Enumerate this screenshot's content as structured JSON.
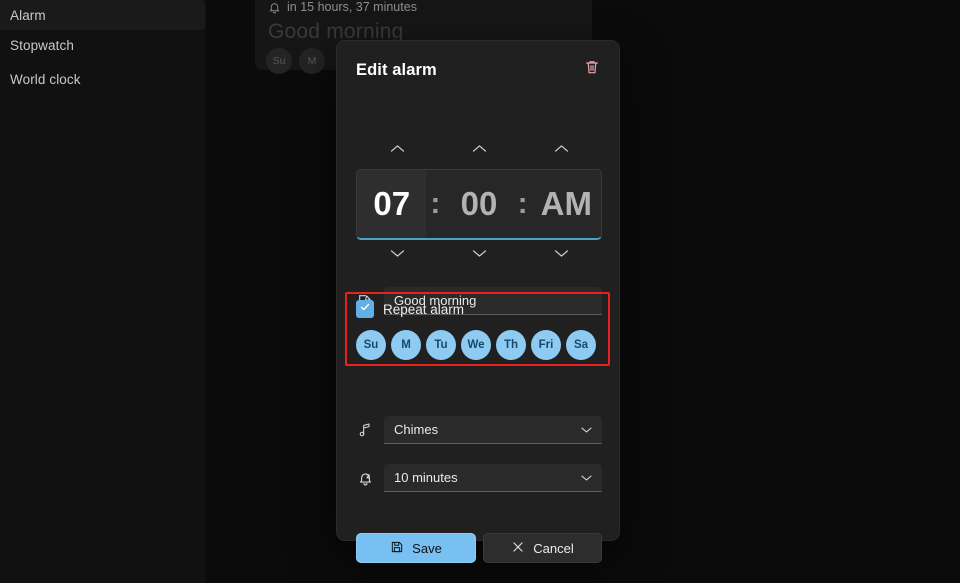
{
  "sidebar": {
    "items": [
      {
        "label": "Alarm",
        "selected": true
      },
      {
        "label": "Stopwatch",
        "selected": false
      },
      {
        "label": "World clock",
        "selected": false
      }
    ]
  },
  "background_alarm": {
    "bell_icon": "bell-icon",
    "countdown": "in 15 hours, 37 minutes",
    "title": "Good morning",
    "days": [
      "Su",
      "M"
    ]
  },
  "dialog": {
    "title": "Edit alarm",
    "delete_icon": "trash-icon",
    "time": {
      "hour": "07",
      "minute": "00",
      "meridiem": "AM",
      "colon": ":",
      "up_icon": "chevron-up-icon",
      "down_icon": "chevron-down-icon",
      "selected_segment": "hour",
      "underline_color": "#4aa3c7"
    },
    "name_field": {
      "icon": "edit-pencil-icon",
      "value": "Good morning"
    },
    "repeat": {
      "label": "Repeat alarm",
      "checked": true,
      "check_icon": "check-icon",
      "days": [
        {
          "label": "Su",
          "on": true
        },
        {
          "label": "M",
          "on": true
        },
        {
          "label": "Tu",
          "on": true
        },
        {
          "label": "We",
          "on": true
        },
        {
          "label": "Th",
          "on": true
        },
        {
          "label": "Fri",
          "on": true
        },
        {
          "label": "Sa",
          "on": true
        }
      ],
      "highlight_color": "#e8221f",
      "day_chip_color": "#8ecbf2"
    },
    "sound": {
      "icon": "music-note-icon",
      "value": "Chimes",
      "chevron": "chevron-down-icon"
    },
    "snooze": {
      "icon": "snooze-bell-icon",
      "value": "10 minutes",
      "chevron": "chevron-down-icon"
    },
    "footer": {
      "save_label": "Save",
      "save_icon": "save-floppy-icon",
      "cancel_label": "Cancel",
      "cancel_icon": "close-x-icon",
      "accent_color": "#79c0f2"
    }
  }
}
